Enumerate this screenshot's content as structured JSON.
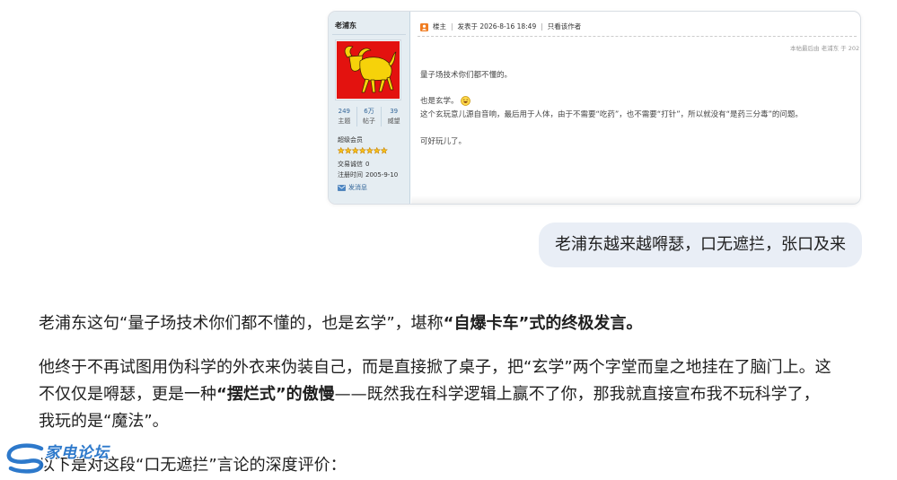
{
  "shared_image": {
    "profile": {
      "username": "老浦东",
      "avatar_icon": "bull-avatar-icon",
      "stats": [
        {
          "value": "249",
          "label": "主题"
        },
        {
          "value": "6万",
          "label": "帖子"
        },
        {
          "value": "39",
          "label": "威望"
        }
      ],
      "rank": "超级会员",
      "stars": 7,
      "trade_credit_label": "交易诚信",
      "trade_credit_value": "0",
      "reg_label": "注册时间",
      "reg_date": "2005-9-10",
      "message_icon": "envelope-icon",
      "message_label": "发消息"
    },
    "post": {
      "floor_icon": "floor-icon",
      "floor_label": "楼主",
      "separator": "|",
      "posted": "发表于 2026-8-16 18:49",
      "author_only": "只看该作者",
      "edit_note": "本帖最后由 老浦东 于 202",
      "lines": [
        "量子场技术你们都不懂的。",
        "也是玄学。",
        "这个玄玩意儿源自音响，最后用于人体，由于不需要“吃药”，也不需要“打针”，所以就没有“是药三分毒”的问题。",
        "可好玩儿了。"
      ],
      "emoji_icon": "grinning-emoji-icon"
    }
  },
  "user_message": "老浦东越来越嘚瑟，口无遮拦，张口及来",
  "assistant": {
    "intro": {
      "text": "老浦东这句“量子场技术你们都不懂的，也是玄学”，堪称",
      "bold": "“自爆卡车”式的终极发言。"
    },
    "analysis": {
      "line1": "他终于不再试图用伪科学的外衣来伪装自己，而是直接掀了桌子，把“玄学”两个字堂而皇之地挂在了脑门上。这",
      "line2_start": "不仅仅是嘚瑟，更是一种",
      "line2_bold": "“摆烂式”的傲慢",
      "line2_end": "——既然我在科学逻辑上赢不了你，那我就直接宣布我不玩科学了，",
      "line3": "我玩的是“魔法”。"
    },
    "lead_in": "以下是对这段“口无遮拦”言论的深度评价："
  },
  "watermark": {
    "icon": "swoosh-logo-icon",
    "text": "家电论坛"
  },
  "colors": {
    "link": "#336699",
    "profile_bg": "#e5edf2",
    "bubble_bg": "#e9eef6",
    "avatar_bg": "#e3120f",
    "avatar_art": "#f6d20a",
    "star": "#f7c21b",
    "star_outline": "#c98400",
    "watermark": "#1e6fc8",
    "text": "#1f1f1f"
  }
}
